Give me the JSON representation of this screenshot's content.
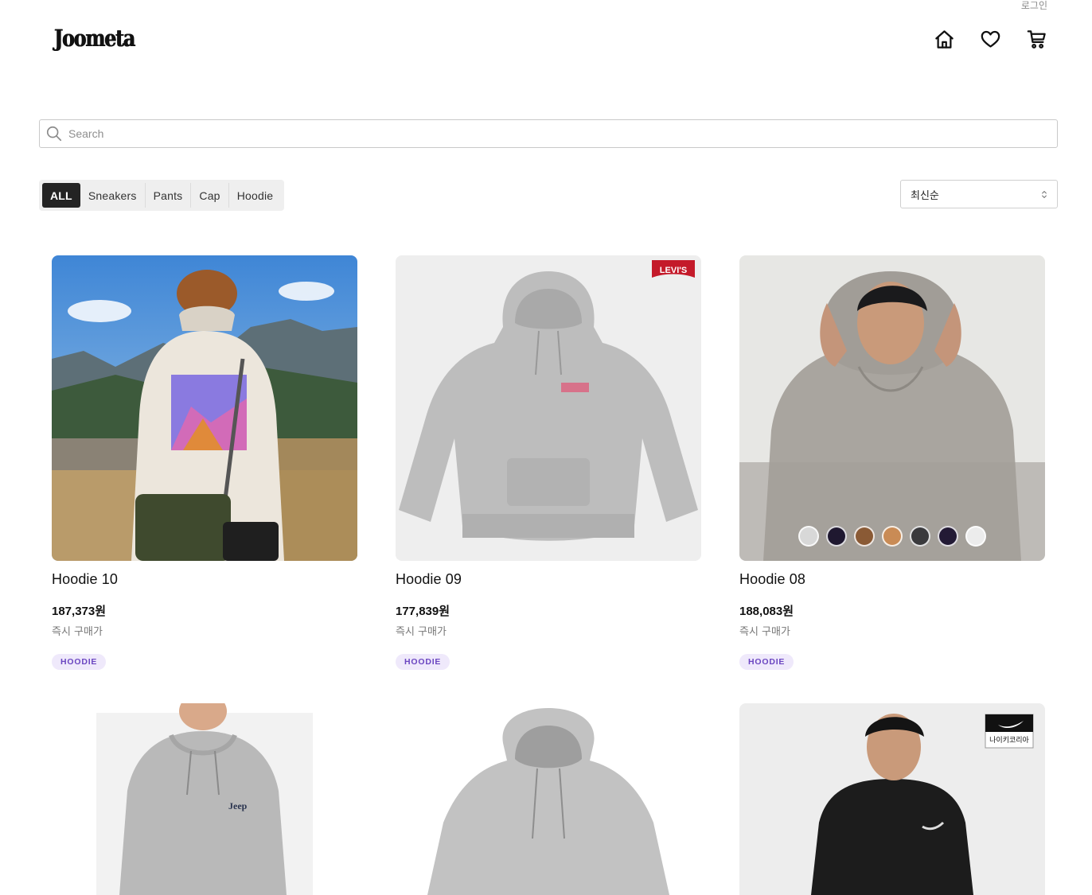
{
  "header": {
    "login_label": "로그인",
    "logo_text": "Joometa",
    "icons": [
      "home-icon",
      "heart-icon",
      "cart-icon"
    ]
  },
  "search": {
    "placeholder": "Search",
    "value": ""
  },
  "categories": {
    "tabs": [
      "ALL",
      "Sneakers",
      "Pants",
      "Cap",
      "Hoodie"
    ],
    "active": "ALL"
  },
  "sort": {
    "selected": "최신순"
  },
  "products": [
    {
      "name": "Hoodie 10",
      "price": "187,373원",
      "price_label": "즉시 구매가",
      "tag": "HOODIE"
    },
    {
      "name": "Hoodie 09",
      "price": "177,839원",
      "price_label": "즉시 구매가",
      "tag": "HOODIE",
      "brand_logo": "LEVI'S"
    },
    {
      "name": "Hoodie 08",
      "price": "188,083원",
      "price_label": "즉시 구매가",
      "tag": "HOODIE",
      "swatches": [
        "#d8d8d8",
        "#1f1830",
        "#8a5a35",
        "#c98b55",
        "#3a3a3d",
        "#231a35",
        "#ececec"
      ]
    },
    {
      "brand_text": "Jeep"
    },
    {},
    {
      "brand_logo": "나이키코리아"
    }
  ],
  "colors": {
    "accent_dark": "#232323",
    "badge_bg": "#efe9fb",
    "badge_text": "#6b46c1"
  }
}
